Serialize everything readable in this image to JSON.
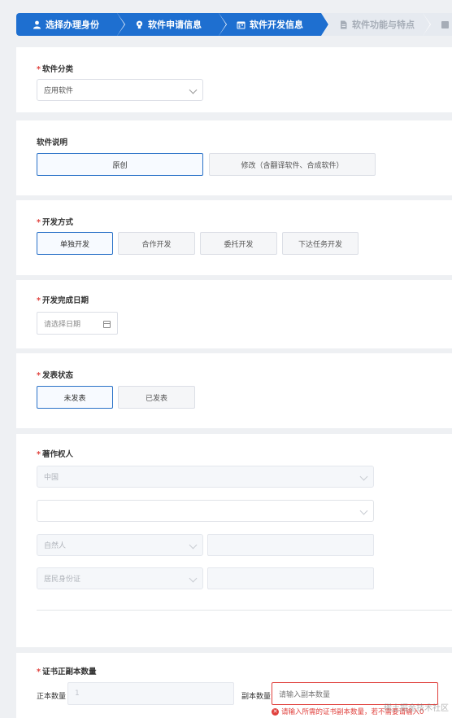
{
  "steps": [
    {
      "label": "选择办理身份",
      "icon": "user-icon"
    },
    {
      "label": "软件申请信息",
      "icon": "bulb-icon"
    },
    {
      "label": "软件开发信息",
      "icon": "calendar-icon"
    },
    {
      "label": "软件功能与特点",
      "icon": "document-icon"
    }
  ],
  "category": {
    "label": "软件分类",
    "value": "应用软件"
  },
  "description": {
    "label": "软件说明",
    "options": [
      "原创",
      "修改（含翻译软件、合成软件）"
    ],
    "selected": "原创"
  },
  "dev_method": {
    "label": "开发方式",
    "options": [
      "单独开发",
      "合作开发",
      "委托开发",
      "下达任务开发"
    ],
    "selected": "单独开发"
  },
  "finish_date": {
    "label": "开发完成日期",
    "placeholder": "请选择日期"
  },
  "publish": {
    "label": "发表状态",
    "options": [
      "未发表",
      "已发表"
    ],
    "selected": "未发表"
  },
  "copyright": {
    "label": "著作权人",
    "country": "中国",
    "province": "",
    "person_type": "自然人",
    "name": "",
    "id_type": "居民身份证",
    "id_number": ""
  },
  "certificate": {
    "label": "证书正副本数量",
    "original_label": "正本数量",
    "original_value": "1",
    "copy_label": "副本数量",
    "copy_placeholder": "请输入副本数量",
    "error": "请输入所需的证书副本数量，若不需要请输入0"
  },
  "watermark": "稀土掘金技术社区",
  "colors": {
    "primary": "#1e6fd0",
    "required": "#e0403c"
  }
}
